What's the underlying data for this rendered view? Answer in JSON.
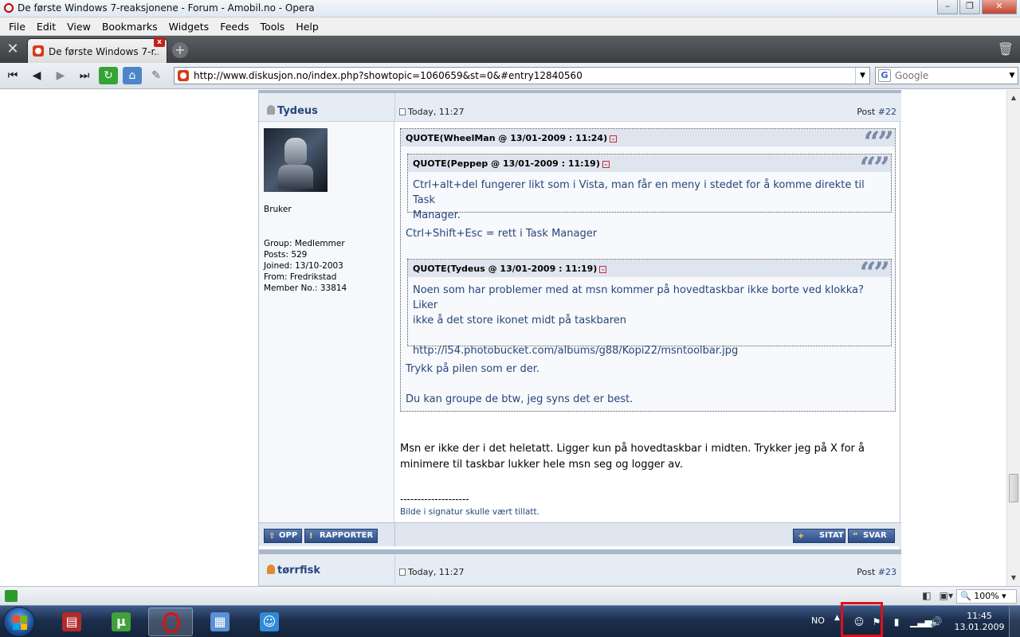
{
  "window": {
    "title": "De første Windows 7-reaksjonene - Forum - Amobil.no - Opera",
    "minimize": "–",
    "maximize": "❐",
    "close": "✕"
  },
  "menu": [
    "File",
    "Edit",
    "View",
    "Bookmarks",
    "Widgets",
    "Feeds",
    "Tools",
    "Help"
  ],
  "tab": {
    "title": "De første Windows 7-r...",
    "close": "x"
  },
  "address": {
    "url": "http://www.diskusjon.no/index.php?showtopic=1060659&st=0&#entry12840560"
  },
  "search": {
    "placeholder": "Google"
  },
  "post22": {
    "author": "Tydeus",
    "time": "Today, 11:27",
    "post_label": "Post ",
    "post_no": "#22",
    "rank": "Bruker",
    "group": "Group: Medlemmer",
    "posts": "Posts: 529",
    "joined": "Joined: 13/10-2003",
    "from": "From: Fredrikstad",
    "member_no": "Member No.: 33814",
    "quote1_head": "QUOTE(WheelMan @ 13/01-2009 : 11:24)",
    "quote1a_head": "QUOTE(Peppep @ 13/01-2009 : 11:19)",
    "quote1a_line1": "Ctrl+alt+del fungerer likt som i Vista, man får en meny i stedet for å komme direkte til Task",
    "quote1a_line2": "Manager.",
    "quote1_reply": "Ctrl+Shift+Esc = rett i Task Manager",
    "quote1b_head": "QUOTE(Tydeus @ 13/01-2009 : 11:19)",
    "quote1b_line1": "Noen som har problemer med at msn kommer på hovedtaskbar ikke borte ved klokka? Liker",
    "quote1b_line2": "ikke å det store ikonet midt på taskbaren",
    "quote1b_link": "http://i54.photobucket.com/albums/g88/Kopi22/msntoolbar.jpg",
    "quote1_reply2": "Trykk på pilen som er der.",
    "quote1_reply3": "Du kan groupe de btw, jeg syns det er best.",
    "body_line1": "Msn er ikke der i det heletatt. Ligger kun på hovedtaskbar i midten. Trykker jeg på X for å",
    "body_line2": "minimere til taskbar lukker hele msn seg og logger av.",
    "sig_line": "--------------------",
    "signature": "Bilde i signatur skulle vært tillatt.",
    "btn_top": "OPP",
    "btn_report": "RAPPORTER",
    "btn_quote": "SITAT",
    "btn_reply": "SVAR"
  },
  "post23": {
    "author": "tørrfisk",
    "time": "Today, 11:27",
    "post_label": "Post ",
    "post_no": "#23"
  },
  "statusbar": {
    "zoom": "100%"
  },
  "taskbar": {
    "language": "NO",
    "time": "11:45",
    "date": "13.01.2009"
  },
  "colors": {
    "link": "#27467a",
    "highlight": "#e0101a",
    "button": "#2d4f88"
  }
}
